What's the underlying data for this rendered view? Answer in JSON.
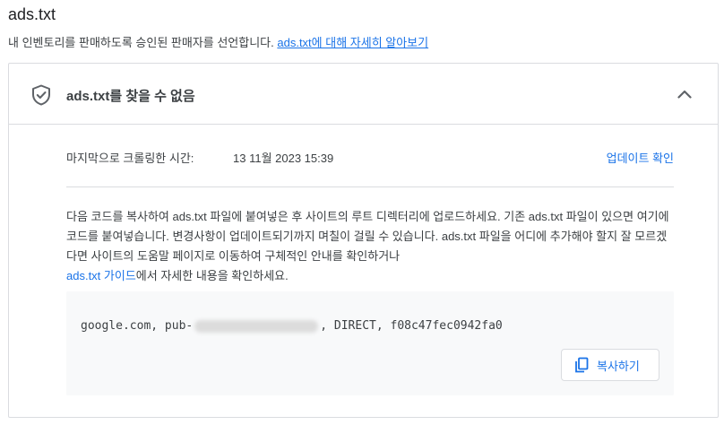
{
  "header": {
    "title": "ads.txt",
    "description": "내 인벤토리를 판매하도록 승인된 판매자를 선언합니다. ",
    "learn_more_link": "ads.txt에 대해 자세히 알아보기"
  },
  "card": {
    "title": "ads.txt를 찾을 수 없음",
    "status_icon": "shield-check-icon",
    "toggle_icon": "chevron-up-icon",
    "last_crawl_label": "마지막으로 크롤링한 시간:",
    "last_crawl_time": "13 11월 2023 15:39",
    "check_update_link": "업데이트 확인",
    "instructions": "다음 코드를 복사하여 ads.txt 파일에 붙여넣은 후 사이트의 루트 디렉터리에 업로드하세요. 기존 ads.txt 파일이 있으면 여기에 코드를 붙여넣습니다. 변경사항이 업데이트되기까지 며칠이 걸릴 수 있습니다. ads.txt 파일을 어디에 추가해야 할지 잘 모르겠다면 사이트의 도움말 페이지로 이동하여 구체적인 안내를 확인하거나 ",
    "guide_link": "ads.txt 가이드",
    "instructions_suffix": "에서 자세한 내용을 확인하세요.",
    "code_prefix": "google.com, pub-",
    "code_suffix": ", DIRECT, f08c47fec0942fa0",
    "copy_button_label": "복사하기",
    "copy_icon": "copy-icon"
  },
  "colors": {
    "accent": "#1a73e8",
    "border": "#dadce0",
    "code_background": "#f8f9fa"
  }
}
